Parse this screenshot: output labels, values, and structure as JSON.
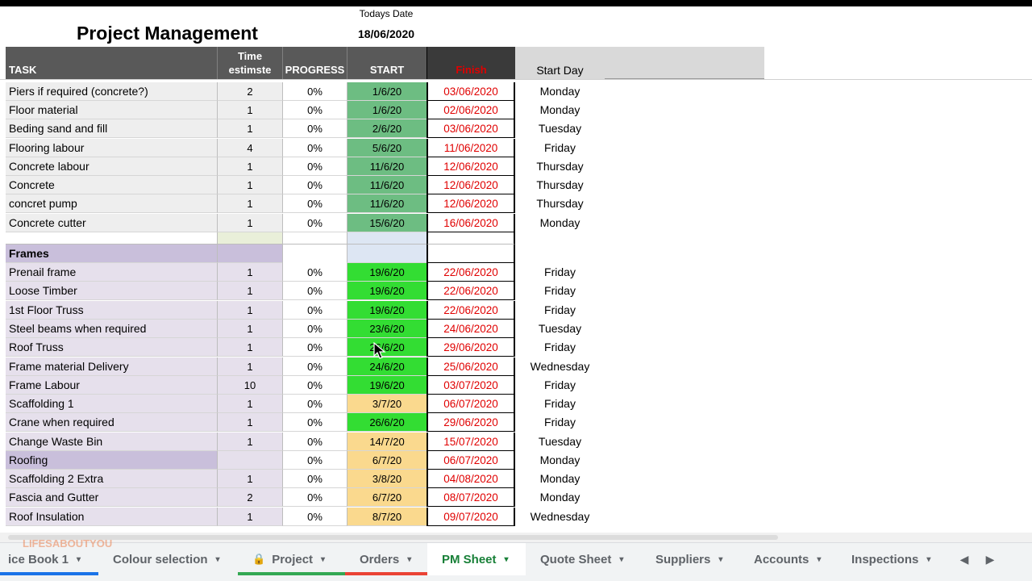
{
  "sheet": {
    "title": "Project Management",
    "today_label": "Todays Date",
    "today_value": "18/06/2020",
    "headers": {
      "task": "TASK",
      "time_line1": "Time",
      "time_line2": "estimste",
      "progress": "PROGRESS",
      "start": "START",
      "finish": "Finish",
      "start_day": "Start Day"
    },
    "rows": [
      {
        "task": "Piers if required (concrete?)",
        "time": "2",
        "progress": "0%",
        "start": "1/6/20",
        "finish": "03/06/2020",
        "day": "Monday",
        "style": "sec-a",
        "start_color": "teal"
      },
      {
        "task": "Floor material",
        "time": "1",
        "progress": "0%",
        "start": "1/6/20",
        "finish": "02/06/2020",
        "day": "Monday",
        "style": "sec-a",
        "start_color": "teal"
      },
      {
        "task": "Beding sand and fill",
        "time": "1",
        "progress": "0%",
        "start": "2/6/20",
        "finish": "03/06/2020",
        "day": "Tuesday",
        "style": "sec-a",
        "start_color": "teal"
      },
      {
        "task": "Flooring labour",
        "time": "4",
        "progress": "0%",
        "start": "5/6/20",
        "finish": "11/06/2020",
        "day": "Friday",
        "style": "sec-a",
        "start_color": "teal"
      },
      {
        "task": "Concrete labour",
        "time": "1",
        "progress": "0%",
        "start": "11/6/20",
        "finish": "12/06/2020",
        "day": "Thursday",
        "style": "sec-a",
        "start_color": "teal"
      },
      {
        "task": "Concrete",
        "time": "1",
        "progress": "0%",
        "start": "11/6/20",
        "finish": "12/06/2020",
        "day": "Thursday",
        "style": "sec-a",
        "start_color": "teal"
      },
      {
        "task": "concret pump",
        "time": "1",
        "progress": "0%",
        "start": "11/6/20",
        "finish": "12/06/2020",
        "day": "Thursday",
        "style": "sec-a",
        "start_color": "teal"
      },
      {
        "task": "Concrete cutter",
        "time": "1",
        "progress": "0%",
        "start": "15/6/20",
        "finish": "16/06/2020",
        "day": "Monday",
        "style": "sec-a",
        "start_color": "teal"
      },
      {
        "task": "",
        "time": "",
        "progress": "",
        "start": "",
        "finish": "",
        "day": "",
        "style": "gap",
        "start_color": "blank"
      },
      {
        "task": "Frames",
        "time": "",
        "progress": "",
        "start": "",
        "finish": "",
        "day": "",
        "style": "section",
        "start_color": "blank"
      },
      {
        "task": "Prenail frame",
        "time": "1",
        "progress": "0%",
        "start": "19/6/20",
        "finish": "22/06/2020",
        "day": "Friday",
        "style": "sec-b",
        "start_color": "green"
      },
      {
        "task": "Loose Timber",
        "time": "1",
        "progress": "0%",
        "start": "19/6/20",
        "finish": "22/06/2020",
        "day": "Friday",
        "style": "sec-b",
        "start_color": "green"
      },
      {
        "task": "1st Floor Truss",
        "time": "1",
        "progress": "0%",
        "start": "19/6/20",
        "finish": "22/06/2020",
        "day": "Friday",
        "style": "sec-b",
        "start_color": "green"
      },
      {
        "task": "Steel beams when required",
        "time": "1",
        "progress": "0%",
        "start": "23/6/20",
        "finish": "24/06/2020",
        "day": "Tuesday",
        "style": "sec-b",
        "start_color": "green"
      },
      {
        "task": "Roof Truss",
        "time": "1",
        "progress": "0%",
        "start": "26/6/20",
        "finish": "29/06/2020",
        "day": "Friday",
        "style": "sec-b",
        "start_color": "green"
      },
      {
        "task": "Frame material Delivery",
        "time": "1",
        "progress": "0%",
        "start": "24/6/20",
        "finish": "25/06/2020",
        "day": "Wednesday",
        "style": "sec-b",
        "start_color": "green"
      },
      {
        "task": "Frame Labour",
        "time": "10",
        "progress": "0%",
        "start": "19/6/20",
        "finish": "03/07/2020",
        "day": "Friday",
        "style": "sec-b",
        "start_color": "green"
      },
      {
        "task": "Scaffolding 1",
        "time": "1",
        "progress": "0%",
        "start": "3/7/20",
        "finish": "06/07/2020",
        "day": "Friday",
        "style": "sec-b",
        "start_color": "yellow"
      },
      {
        "task": "Crane when required",
        "time": "1",
        "progress": "0%",
        "start": "26/6/20",
        "finish": "29/06/2020",
        "day": "Friday",
        "style": "sec-b",
        "start_color": "green"
      },
      {
        "task": "Change Waste Bin",
        "time": "1",
        "progress": "0%",
        "start": "14/7/20",
        "finish": "15/07/2020",
        "day": "Tuesday",
        "style": "sec-b",
        "start_color": "yellow"
      },
      {
        "task": "Roofing",
        "time": "",
        "progress": "0%",
        "start": "6/7/20",
        "finish": "06/07/2020",
        "day": "Monday",
        "style": "sub",
        "start_color": "yellow"
      },
      {
        "task": "Scaffolding 2 Extra",
        "time": "1",
        "progress": "0%",
        "start": "3/8/20",
        "finish": "04/08/2020",
        "day": "Monday",
        "style": "sec-b",
        "start_color": "yellow"
      },
      {
        "task": "Fascia and Gutter",
        "time": "2",
        "progress": "0%",
        "start": "6/7/20",
        "finish": "08/07/2020",
        "day": "Monday",
        "style": "sec-b",
        "start_color": "yellow"
      },
      {
        "task": "Roof Insulation",
        "time": "1",
        "progress": "0%",
        "start": "8/7/20",
        "finish": "09/07/2020",
        "day": "Wednesday",
        "style": "sec-b",
        "start_color": "yellow"
      }
    ]
  },
  "colors": {
    "teal": "#6dbd82",
    "green": "#33dd33",
    "yellow": "#fad98e",
    "finish_text": "#e00000",
    "active_tab": "#188038"
  },
  "tabs": [
    {
      "label": "ice Book 1",
      "arrow": "▾",
      "lock": false,
      "active": false,
      "strip": "#1a73e8"
    },
    {
      "label": "Colour selection",
      "arrow": "▾",
      "lock": false,
      "active": false,
      "strip": ""
    },
    {
      "label": "Project",
      "arrow": "▾",
      "lock": true,
      "active": false,
      "strip": "#34a853"
    },
    {
      "label": "Orders",
      "arrow": "▾",
      "lock": false,
      "active": false,
      "strip": "#ea4335"
    },
    {
      "label": "PM Sheet",
      "arrow": "▾",
      "lock": false,
      "active": true,
      "strip": ""
    },
    {
      "label": "Quote Sheet",
      "arrow": "▾",
      "lock": false,
      "active": false,
      "strip": ""
    },
    {
      "label": "Suppliers",
      "arrow": "▾",
      "lock": false,
      "active": false,
      "strip": ""
    },
    {
      "label": "Accounts",
      "arrow": "▾",
      "lock": false,
      "active": false,
      "strip": ""
    },
    {
      "label": "Inspections",
      "arrow": "▾",
      "lock": false,
      "active": false,
      "strip": ""
    }
  ],
  "nav": {
    "left_icon": "◀",
    "right_icon": "▶"
  },
  "icons": {
    "lock": "lock-icon",
    "dropdown": "chevron-down-icon",
    "cursor": "mouse-pointer-icon"
  },
  "watermark": "LIFESABOUTYOU"
}
